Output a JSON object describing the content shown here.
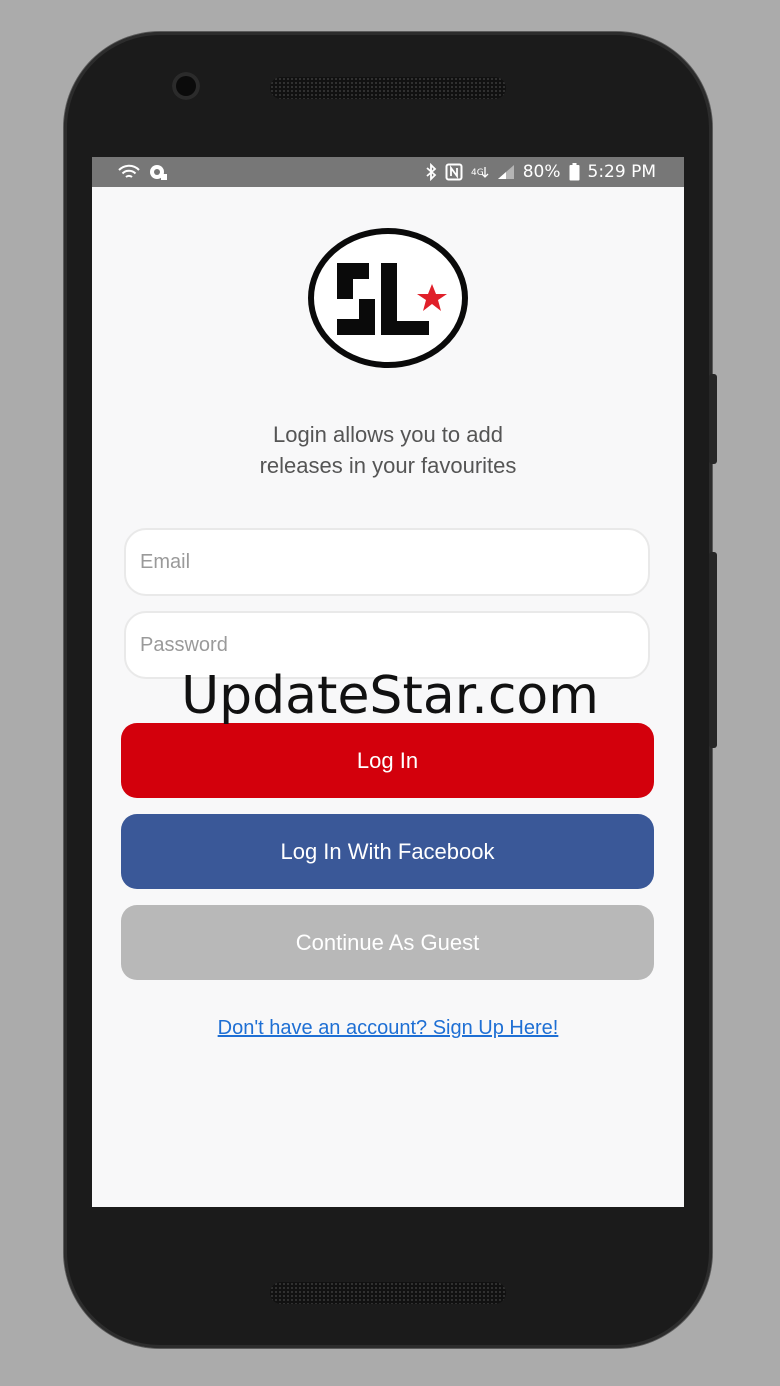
{
  "status_bar": {
    "battery_percent": "80%",
    "time": "5:29 PM",
    "left_icons": [
      "wifi-icon",
      "sync-icon"
    ],
    "right_icons": [
      "bluetooth-icon",
      "nfc-icon",
      "network-4g-icon",
      "signal-icon",
      "battery-icon"
    ]
  },
  "login": {
    "subtitle_line1": "Login allows you to add",
    "subtitle_line2": "releases in your favourites",
    "email_placeholder": "Email",
    "password_placeholder": "Password",
    "login_button": "Log In",
    "facebook_button": "Log In With Facebook",
    "guest_button": "Continue As Guest",
    "signup_link": "Don't have an account? Sign Up Here!"
  },
  "watermark": "UpdateStar.com",
  "colors": {
    "login_button": "#d3000c",
    "facebook_button": "#3a5898",
    "guest_button": "#b8b8b8",
    "link": "#1e6fd4",
    "logo_star": "#e0202a"
  }
}
